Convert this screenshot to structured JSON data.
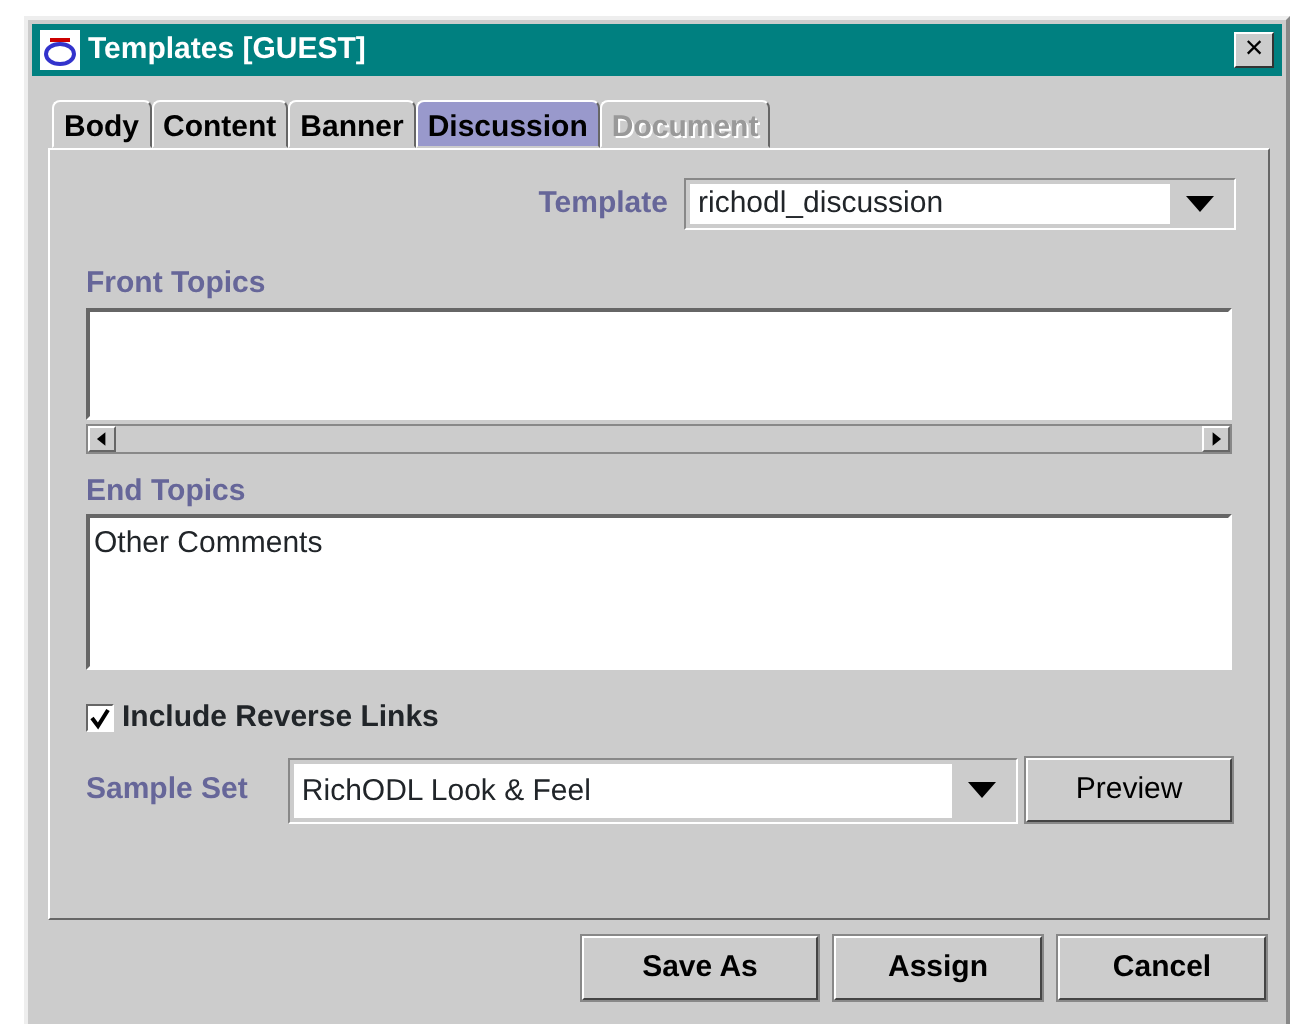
{
  "window": {
    "title": "Templates [GUEST]",
    "close": "×"
  },
  "tabs": [
    {
      "label": "Body",
      "selected": false,
      "disabled": false
    },
    {
      "label": "Content",
      "selected": false,
      "disabled": false
    },
    {
      "label": "Banner",
      "selected": false,
      "disabled": false
    },
    {
      "label": "Discussion",
      "selected": true,
      "disabled": false
    },
    {
      "label": "Document",
      "selected": false,
      "disabled": true
    }
  ],
  "template": {
    "label": "Template",
    "value": "richodl_discussion"
  },
  "front_topics": {
    "label": "Front Topics"
  },
  "end_topics": {
    "label": "End Topics",
    "value": "Other Comments"
  },
  "include_reverse_links": {
    "label": "Include Reverse Links",
    "checked": true
  },
  "sample_set": {
    "label": "Sample Set",
    "value": "RichODL Look & Feel",
    "button": "Preview"
  },
  "buttons": [
    "Save As",
    "Assign",
    "Cancel"
  ]
}
